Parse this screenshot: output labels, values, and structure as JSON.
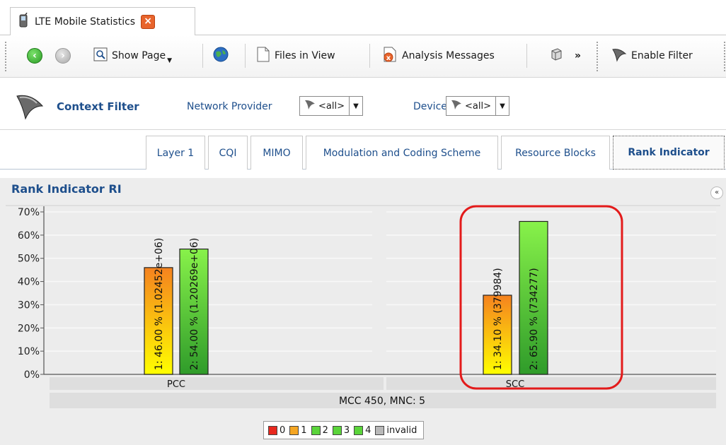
{
  "window": {
    "tab_title": "LTE Mobile Statistics",
    "close_glyph": "×"
  },
  "toolbar": {
    "show_page": "Show Page",
    "files_in_view": "Files in View",
    "analysis_messages": "Analysis Messages",
    "overflow": "»",
    "enable_filter": "Enable Filter"
  },
  "context_filter": {
    "title": "Context Filter",
    "network_provider_label": "Network Provider",
    "network_provider_value": "<all>",
    "device_label": "Device",
    "device_value": "<all>"
  },
  "tabs": [
    {
      "label": "Layer 1"
    },
    {
      "label": "CQI"
    },
    {
      "label": "MIMO"
    },
    {
      "label": "Modulation and Coding Scheme"
    },
    {
      "label": "Resource Blocks"
    },
    {
      "label": "Rank Indicator",
      "active": true
    }
  ],
  "panel": {
    "title": "Rank Indicator RI",
    "collapse_glyph": "«"
  },
  "chart_data": {
    "type": "bar",
    "title": "Rank Indicator RI",
    "ylim": [
      0,
      70
    ],
    "yticks": [
      "0%",
      "10%",
      "20%",
      "30%",
      "40%",
      "50%",
      "60%",
      "70%"
    ],
    "group_axis_label": "MCC 450, MNC: 5",
    "categories": [
      "PCC",
      "SCC"
    ],
    "bars": [
      {
        "category": "PCC",
        "rank": "1",
        "value": 46.0,
        "label": "1: 46.00 % (1.02452e+06)"
      },
      {
        "category": "PCC",
        "rank": "2",
        "value": 54.0,
        "label": "2: 54.00 % (1.20269e+06)"
      },
      {
        "category": "SCC",
        "rank": "1",
        "value": 34.1,
        "label": "1: 34.10 % (379984)"
      },
      {
        "category": "SCC",
        "rank": "2",
        "value": 65.9,
        "label": "2: 65.90 % (734277)"
      }
    ],
    "legend": [
      {
        "label": "0",
        "color": "#e8281e"
      },
      {
        "label": "1",
        "color": "#f5a623"
      },
      {
        "label": "2",
        "color": "#5ad43a"
      },
      {
        "label": "3",
        "color": "#5ad43a"
      },
      {
        "label": "4",
        "color": "#5ad43a"
      },
      {
        "label": "invalid",
        "color": "#b8b8b8"
      }
    ],
    "legend_placement": "bottom",
    "highlight": "SCC",
    "grid": true
  },
  "colors": {
    "accent": "#1e4f8c",
    "highlight_ring": "#e31b1b",
    "rank1_gradient": [
      "#ffff00",
      "#f5821f"
    ],
    "rank2_gradient": [
      "#2f9b2a",
      "#88f24a"
    ]
  }
}
